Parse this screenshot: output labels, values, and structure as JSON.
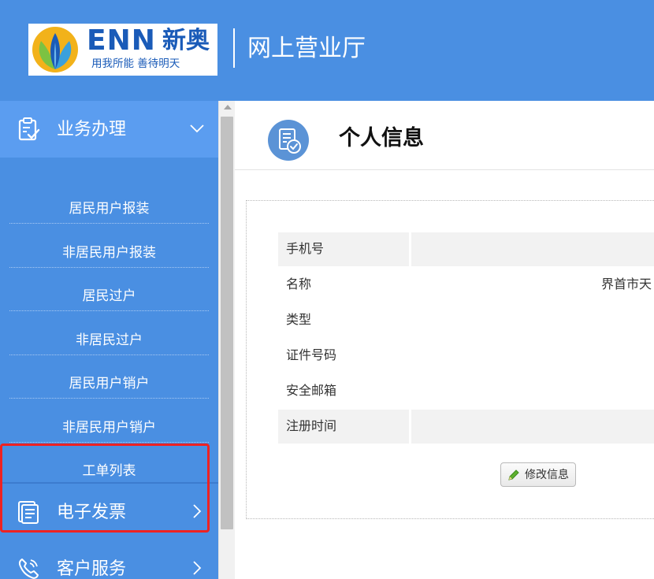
{
  "header": {
    "logo_brand": "ENN",
    "logo_cn": "新奥",
    "logo_slogan": "用我所能  善待明天",
    "title": "网上营业厅"
  },
  "sidebar": {
    "groups": [
      {
        "label": "业务办理",
        "icon": "clipboard-check-icon",
        "expanded": true
      },
      {
        "label": "电子发票",
        "icon": "invoice-icon",
        "expanded": false
      },
      {
        "label": "客户服务",
        "icon": "phone-icon",
        "expanded": false
      }
    ],
    "sub_items": [
      "居民用户报装",
      "非居民用户报装",
      "居民过户",
      "非居民过户",
      "居民用户销户",
      "非居民用户销户",
      "工单列表"
    ],
    "highlighted_items": [
      "居民用户销户",
      "非居民用户销户"
    ]
  },
  "main": {
    "title": "个人信息",
    "title_icon": "document-check-icon",
    "fields": [
      {
        "label": "手机号",
        "value": ""
      },
      {
        "label": "名称",
        "value": "界首市天"
      },
      {
        "label": "类型",
        "value": ""
      },
      {
        "label": "证件号码",
        "value": ""
      },
      {
        "label": "安全邮箱",
        "value": ""
      },
      {
        "label": "注册时间",
        "value": ""
      }
    ],
    "edit_button": "修改信息"
  },
  "colors": {
    "primary": "#4a8fe2",
    "active_menu": "#5b9df0",
    "highlight": "#ee2222",
    "brand_blue": "#1a5bb8"
  }
}
